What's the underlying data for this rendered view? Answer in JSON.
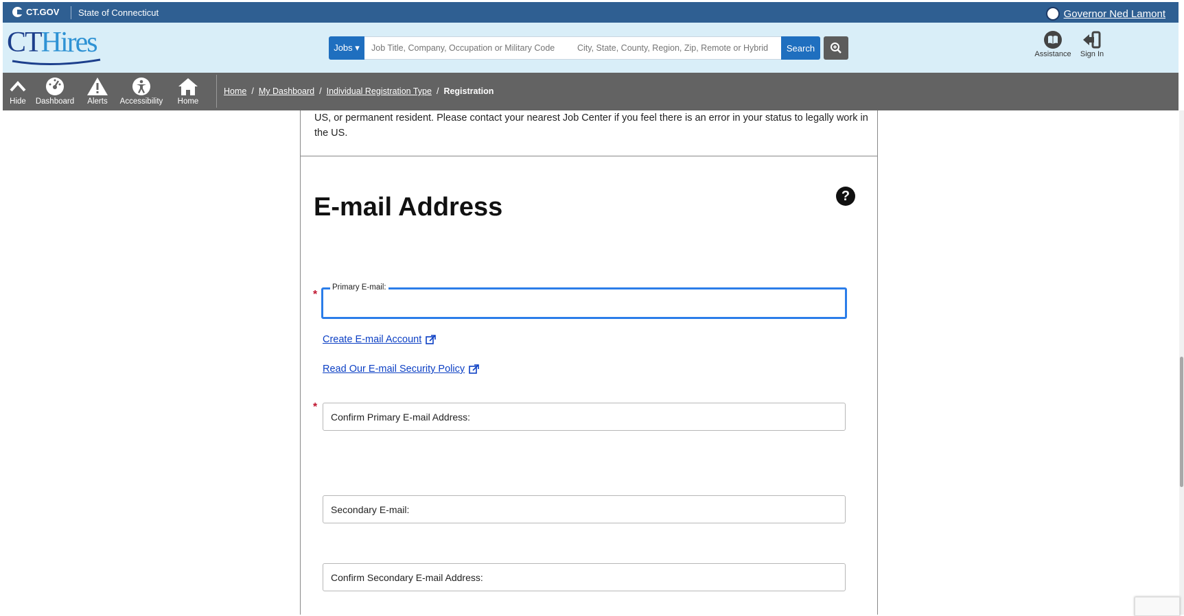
{
  "ctgov": {
    "logo_text": "CT.GOV",
    "state_label": "State of Connecticut",
    "governor_link": "Governor Ned Lamont"
  },
  "header": {
    "brand_ct": "CT",
    "brand_hires": "Hires",
    "jobs_dropdown": "Jobs",
    "search_job_placeholder": "Job Title, Company, Occupation or Military Code",
    "search_location_placeholder": "City, State, County, Region, Zip, Remote or Hybrid",
    "search_button": "Search",
    "assistance_label": "Assistance",
    "signin_label": "Sign In"
  },
  "toolbar": {
    "hide": "Hide",
    "dashboard": "Dashboard",
    "alerts": "Alerts",
    "accessibility": "Accessibility",
    "home": "Home"
  },
  "breadcrumb": {
    "home": "Home",
    "dashboard": "My Dashboard",
    "reg_type": "Individual Registration Type",
    "current": "Registration"
  },
  "content": {
    "intro_text": "US, or permanent resident. Please contact your nearest Job Center if you feel there is an error in your status to legally work in the US.",
    "section_title": "E-mail Address",
    "help_symbol": "?",
    "required_mark": "*",
    "primary_email_label": "Primary E-mail:",
    "create_account_link": "Create E-mail Account",
    "security_policy_link": "Read Our E-mail Security Policy",
    "confirm_primary_label": "Confirm Primary E-mail Address:",
    "secondary_email_label": "Secondary E-mail:",
    "confirm_secondary_label": "Confirm Secondary E-mail Address:"
  },
  "colors": {
    "ctbar": "#2f5f92",
    "header_bg": "#d9eef8",
    "toolbar_bg": "#636363",
    "accent_blue": "#1f6fbf",
    "focus_blue": "#2b7de9",
    "required_red": "#c0152f"
  }
}
